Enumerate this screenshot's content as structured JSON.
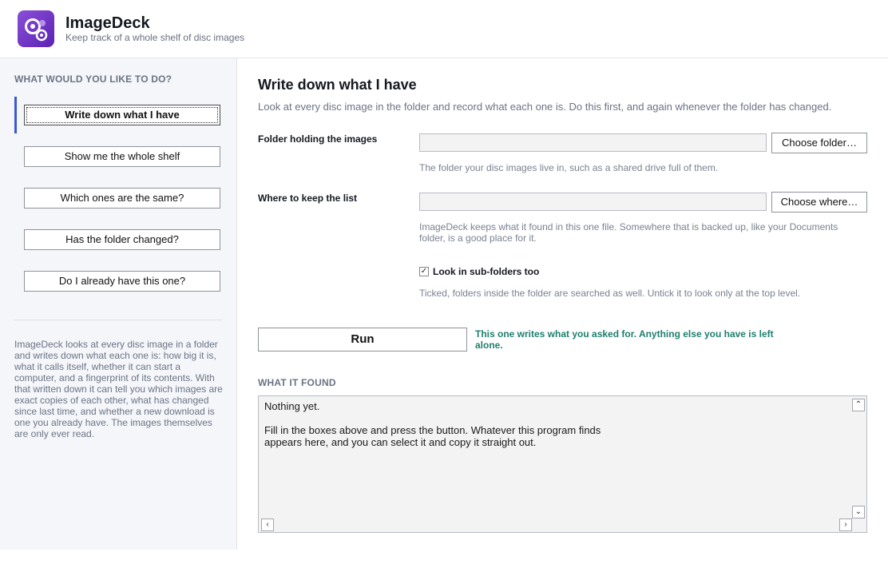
{
  "app": {
    "title": "ImageDeck",
    "subtitle": "Keep track of a whole shelf of disc images",
    "accent": "#3b56d6",
    "logo_icon": "gears-icon"
  },
  "sidebar": {
    "heading": "WHAT WOULD YOU LIKE TO DO?",
    "items": [
      {
        "label": "Write down what I have",
        "active": true
      },
      {
        "label": "Show me the whole shelf",
        "active": false
      },
      {
        "label": "Which ones are the same?",
        "active": false
      },
      {
        "label": "Has the folder changed?",
        "active": false
      },
      {
        "label": "Do I already have this one?",
        "active": false
      }
    ],
    "about": "ImageDeck looks at every disc image in a folder and writes down what each one is: how big it is, what it calls itself, whether it can start a computer, and a fingerprint of its contents. With that written down it can tell you which images are exact copies of each other, what has changed since last time, and whether a new download is one you already have. The images themselves are only ever read."
  },
  "main": {
    "title": "Write down what I have",
    "description": "Look at every disc image in the folder and record what each one is. Do this first, and again whenever the folder has changed.",
    "folder": {
      "label": "Folder holding the images",
      "value": "",
      "button": "Choose folder…",
      "help": "The folder your disc images live in, such as a shared drive full of them."
    },
    "list": {
      "label": "Where to keep the list",
      "value": "",
      "button": "Choose where…",
      "help": "ImageDeck keeps what it found in this one file. Somewhere that is backed up, like your Documents folder, is a good place for it."
    },
    "subfolders": {
      "checked": true,
      "label": "Look in sub-folders too",
      "help": "Ticked, folders inside the folder are searched as well. Untick it to look only at the top level."
    },
    "run": {
      "label": "Run",
      "note": "This one writes what you asked for. Anything else you have is left alone.",
      "note_color": "#1e7f6f"
    },
    "found": {
      "heading": "WHAT IT FOUND",
      "text": "Nothing yet.\n\nFill in the boxes above and press the button. Whatever this program finds\nappears here, and you can select it and copy it straight out."
    }
  }
}
